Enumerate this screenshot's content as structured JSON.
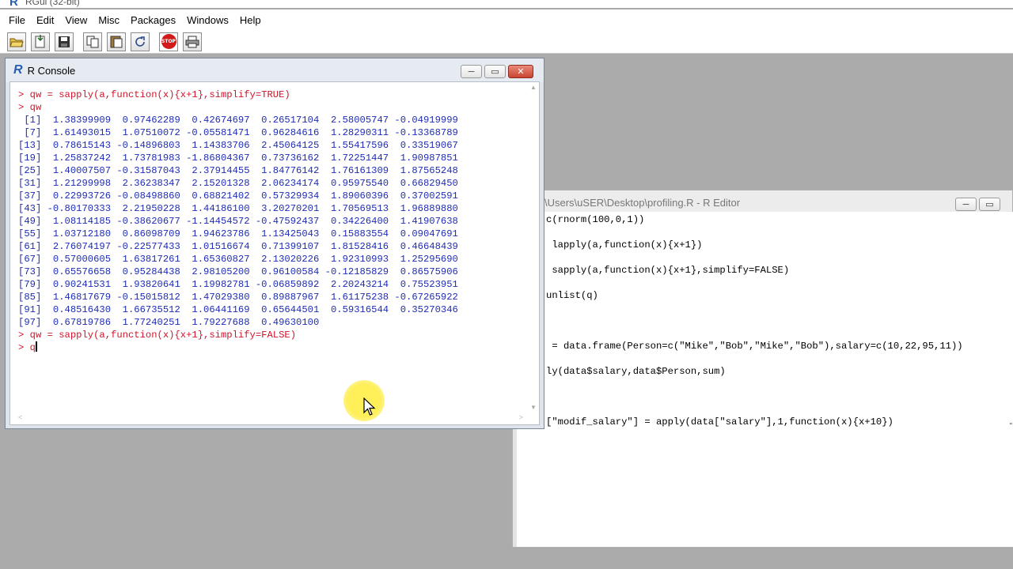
{
  "app": {
    "title": "RGui (32-bit)"
  },
  "menu": [
    "File",
    "Edit",
    "View",
    "Misc",
    "Packages",
    "Windows",
    "Help"
  ],
  "toolbar": {
    "buttons": [
      "open-script",
      "load-workspace",
      "save-workspace",
      "copy",
      "paste",
      "copy-paste",
      "stop",
      "print"
    ],
    "stop_label": "STOP"
  },
  "console": {
    "title": "R Console",
    "cmd1": "> qw = sapply(a,function(x){x+1},simplify=TRUE)",
    "cmd2": "> qw",
    "rows": [
      " [1]  1.38399909  0.97462289  0.42674697  0.26517104  2.58005747 -0.04919999",
      " [7]  1.61493015  1.07510072 -0.05581471  0.96284616  1.28290311 -0.13368789",
      "[13]  0.78615143 -0.14896803  1.14383706  2.45064125  1.55417596  0.33519067",
      "[19]  1.25837242  1.73781983 -1.86804367  0.73736162  1.72251447  1.90987851",
      "[25]  1.40007507 -0.31587043  2.37914455  1.84776142  1.76161309  1.87565248",
      "[31]  1.21299998  2.36238347  2.15201328  2.06234174  0.95975540  0.66829450",
      "[37]  0.22993726 -0.08498860  0.68821402  0.57329934  1.89060396  0.37002591",
      "[43] -0.80170333  2.21950228  1.44186100  3.20270201  1.70569513  1.96889880",
      "[49]  1.08114185 -0.38620677 -1.14454572 -0.47592437  0.34226400  1.41907638",
      "[55]  1.03712180  0.86098709  1.94623786  1.13425043  0.15883554  0.09047691",
      "[61]  2.76074197 -0.22577433  1.01516674  0.71399107  1.81528416  0.46648439",
      "[67]  0.57000605  1.63817261  1.65360827  2.13020226  1.92310993  1.25295690",
      "[73]  0.65576658  0.95284438  2.98105200  0.96100584 -0.12185829  0.86575906",
      "[79]  0.90241531  1.93820641  1.19982781 -0.06859892  2.20243214  0.75523951",
      "[85]  1.46817679 -0.15015812  1.47029380  0.89887967  1.61175238 -0.67265922",
      "[91]  0.48516430  1.66735512  1.06441169  0.65644501  0.59316544  0.35270346",
      "[97]  0.67819786  1.77240251  1.79227688  0.49630100"
    ],
    "cmd3": "> qw = sapply(a,function(x){x+1},simplify=FALSE)",
    "prompt": "> ",
    "current_input": "q"
  },
  "editor": {
    "title": "\\Users\\uSER\\Desktop\\profiling.R - R Editor",
    "lines": [
      "c(rnorm(100,0,1))",
      "",
      " lapply(a,function(x){x+1})",
      "",
      " sapply(a,function(x){x+1},simplify=FALSE)",
      "",
      "unlist(q)",
      "",
      "",
      "",
      " = data.frame(Person=c(\"Mike\",\"Bob\",\"Mike\",\"Bob\"),salary=c(10,22,95,11))",
      "",
      "ly(data$salary,data$Person,sum)",
      "",
      "",
      "",
      "[\"modif_salary\"] = apply(data[\"salary\"],1,function(x){x+10})"
    ],
    "right_edge_mark": "\""
  }
}
